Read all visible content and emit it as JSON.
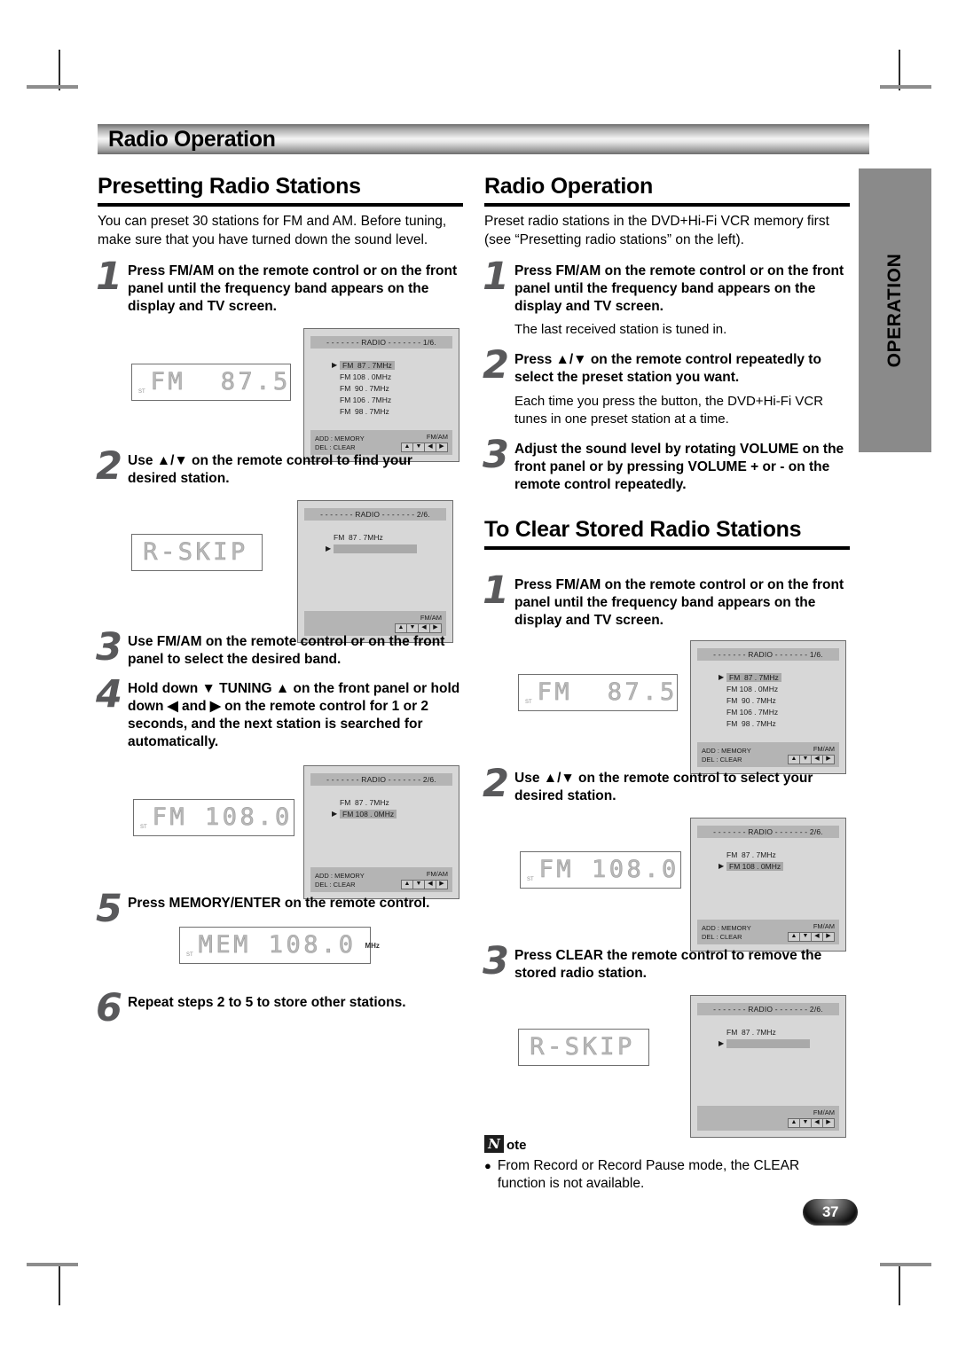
{
  "chapter": {
    "title": "Radio Operation"
  },
  "side_tab": {
    "label": "OPERATION"
  },
  "page_number": "37",
  "left": {
    "heading": "Presetting Radio Stations",
    "intro": "You can preset 30 stations for FM and AM. Before tuning, make sure that you have turned down the sound level.",
    "steps": [
      {
        "num": "1",
        "text": "Press FM/AM on the remote control or on the front panel until the frequency band appears on the display and TV screen."
      },
      {
        "num": "2",
        "text": "Use ▲/▼ on the remote control to find your desired station."
      },
      {
        "num": "3",
        "text": "Use FM/AM on the remote control or on the front panel to select the desired band."
      },
      {
        "num": "4",
        "text": "Hold down ▼ TUNING ▲ on the front panel or hold down ◀ and ▶ on the remote control for 1 or 2 seconds, and the next station is searched for automatically."
      },
      {
        "num": "5",
        "text": "Press MEMORY/ENTER on the remote control."
      },
      {
        "num": "6",
        "text": "Repeat steps 2 to 5 to store other stations."
      }
    ],
    "vfd": [
      {
        "status": "ST",
        "text": "FM  87.5",
        "indicator": "block"
      },
      {
        "status": "",
        "text": "R-SKIP",
        "indicator": "none"
      },
      {
        "status": "ST",
        "text": "FM 108.0",
        "indicator": "block"
      },
      {
        "status": "ST",
        "text": "MEM 108.0",
        "indicator": "MHz"
      }
    ],
    "osd": [
      {
        "title": "- - - - - - - RADIO - - - - - - - 1/6.",
        "rows": [
          {
            "freq": "FM  87 . 7MHz",
            "selected": true,
            "blank": false
          },
          {
            "freq": "FM 108 . 0MHz",
            "selected": false,
            "blank": false
          },
          {
            "freq": "FM  90 . 7MHz",
            "selected": false,
            "blank": false
          },
          {
            "freq": "FM 106 . 7MHz",
            "selected": false,
            "blank": false
          },
          {
            "freq": "FM  98 . 7MHz",
            "selected": false,
            "blank": false
          }
        ],
        "foot_left": [
          "ADD : MEMORY",
          "DEL : CLEAR"
        ],
        "foot_right": "FM/AM",
        "pads": [
          "▲",
          "▼",
          "◀",
          "▶"
        ]
      },
      {
        "title": "- - - - - - - RADIO - - - - - - - 2/6.",
        "rows": [
          {
            "freq": "FM  87 . 7MHz",
            "selected": false,
            "blank": false
          },
          {
            "freq": "",
            "selected": true,
            "blank": true
          }
        ],
        "foot_left": [],
        "foot_right": "FM/AM",
        "pads": [
          "▲",
          "▼",
          "◀",
          "▶"
        ]
      },
      {
        "title": "- - - - - - - RADIO - - - - - - - 2/6.",
        "rows": [
          {
            "freq": "FM  87 . 7MHz",
            "selected": false,
            "blank": false
          },
          {
            "freq": "FM 108 . 0MHz",
            "selected": true,
            "blank": false
          }
        ],
        "foot_left": [
          "ADD : MEMORY",
          "DEL : CLEAR"
        ],
        "foot_right": "FM/AM",
        "pads": [
          "▲",
          "▼",
          "◀",
          "▶"
        ]
      }
    ]
  },
  "right": {
    "heading1": "Radio Operation",
    "intro1": "Preset radio stations in the DVD+Hi-Fi VCR memory first (see “Presetting radio stations” on the left).",
    "steps1": [
      {
        "num": "1",
        "text": "Press FM/AM on the remote control or on the front panel until the frequency band appears on the display and TV screen.",
        "sub": "The last received station is tuned in."
      },
      {
        "num": "2",
        "text": "Press ▲/▼ on the remote control repeatedly to select the preset station you want.",
        "sub": "Each time you press the button, the DVD+Hi-Fi VCR tunes in one preset station at a time."
      },
      {
        "num": "3",
        "text": "Adjust the sound level by rotating VOLUME on the front panel or by pressing VOLUME + or - on the remote control repeatedly.",
        "sub": ""
      }
    ],
    "heading2": "To Clear Stored Radio Stations",
    "steps2": [
      {
        "num": "1",
        "text": "Press FM/AM on the remote control or on the front panel until the frequency band appears on the display and TV screen."
      },
      {
        "num": "2",
        "text": "Use ▲/▼ on the remote control to select your desired station."
      },
      {
        "num": "3",
        "text": "Press CLEAR the remote control to remove the stored radio station."
      }
    ],
    "vfd": [
      {
        "status": "ST",
        "text": "FM  87.5",
        "indicator": "block"
      },
      {
        "status": "ST",
        "text": "FM 108.0",
        "indicator": "block"
      },
      {
        "status": "",
        "text": "R-SKIP",
        "indicator": "none"
      }
    ],
    "osd": [
      {
        "title": "- - - - - - - RADIO - - - - - - - 1/6.",
        "rows": [
          {
            "freq": "FM  87 . 7MHz",
            "selected": true,
            "blank": false
          },
          {
            "freq": "FM 108 . 0MHz",
            "selected": false,
            "blank": false
          },
          {
            "freq": "FM  90 . 7MHz",
            "selected": false,
            "blank": false
          },
          {
            "freq": "FM 106 . 7MHz",
            "selected": false,
            "blank": false
          },
          {
            "freq": "FM  98 . 7MHz",
            "selected": false,
            "blank": false
          }
        ],
        "foot_left": [
          "ADD : MEMORY",
          "DEL : CLEAR"
        ],
        "foot_right": "FM/AM",
        "pads": [
          "▲",
          "▼",
          "◀",
          "▶"
        ]
      },
      {
        "title": "- - - - - - - RADIO - - - - - - - 2/6.",
        "rows": [
          {
            "freq": "FM  87 . 7MHz",
            "selected": false,
            "blank": false
          },
          {
            "freq": "FM 108 . 0MHz",
            "selected": true,
            "blank": false
          }
        ],
        "foot_left": [
          "ADD : MEMORY",
          "DEL : CLEAR"
        ],
        "foot_right": "FM/AM",
        "pads": [
          "▲",
          "▼",
          "◀",
          "▶"
        ]
      },
      {
        "title": "- - - - - - - RADIO - - - - - - - 2/6.",
        "rows": [
          {
            "freq": "FM  87 . 7MHz",
            "selected": false,
            "blank": false
          },
          {
            "freq": "",
            "selected": true,
            "blank": true
          }
        ],
        "foot_left": [],
        "foot_right": "FM/AM",
        "pads": [
          "▲",
          "▼",
          "◀",
          "▶"
        ]
      }
    ],
    "note": {
      "icon_letter": "N",
      "word": "ote",
      "bullet": "●",
      "text": "From Record or Record Pause mode, the CLEAR function is not available."
    }
  }
}
